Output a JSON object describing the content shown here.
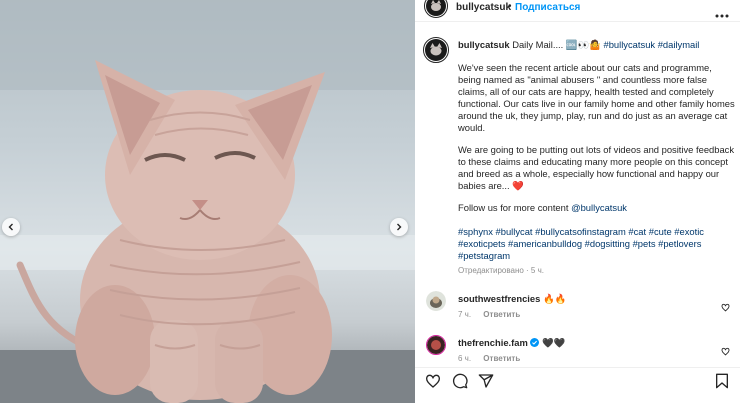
{
  "post": {
    "author": "bullycatsuk",
    "follow_label": "Подписаться",
    "separator": "•",
    "caption_head": "Daily Mail.... 🆒👀🤷",
    "caption_head_tags": "#bullycatsuk #dailymail",
    "paragraph1": "We've seen the recent article about our cats and programme, being named as \"animal abusers \" and countless more false claims, all of our cats are happy, health tested and completely functional. Our cats live in our family home and other family homes around the uk, they jump, play, run and do just as an average cat would.",
    "paragraph2": "We are going to be putting out lots of videos and positive feedback to these claims and educating many more people on this concept and breed as a whole, especially how functional and happy our babies are... ❤️",
    "follow_text": "Follow us for more content",
    "follow_handle": "@bullycatsuk",
    "hashtags": "#sphynx #bullycat #bullycatsofinstagram #cat #cute #exotic #exoticpets #americanbulldog #dogsitting #pets #petlovers #petstagram",
    "edited_meta": "Отредактировано · 5 ч."
  },
  "comments": [
    {
      "user": "southwestfrencies",
      "text": "🔥🔥",
      "time": "7 ч.",
      "reply_label": "Ответить"
    },
    {
      "user": "thefrenchie.fam",
      "text": "🖤🖤",
      "time": "6 ч.",
      "reply_label": "Ответить"
    }
  ],
  "icons": [
    "more-icon",
    "chevron-left-icon",
    "chevron-right-icon",
    "heart-icon",
    "comment-icon",
    "share-icon",
    "bookmark-icon",
    "verified-icon"
  ],
  "colors": {
    "link": "#0095f6",
    "hashtag": "#00376b",
    "muted": "#8e8e8e",
    "heart": "#ed4956"
  }
}
